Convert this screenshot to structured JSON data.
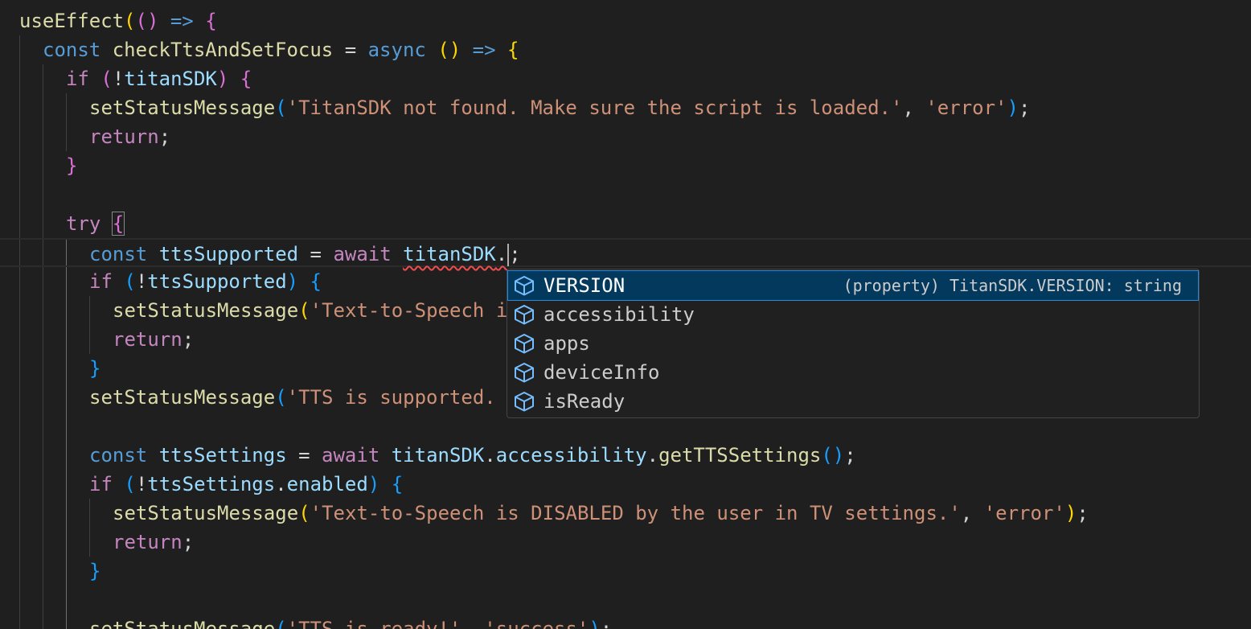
{
  "editor": {
    "comment_fragment": "// ...",
    "lines": [
      {
        "tokens": [
          {
            "t": "useEffect",
            "c": "fn"
          },
          {
            "t": "(",
            "c": "b1"
          },
          {
            "t": "()",
            "c": "b2"
          },
          {
            "t": " => ",
            "c": "kw"
          },
          {
            "t": "{",
            "c": "b2"
          }
        ]
      },
      {
        "tokens": [
          {
            "t": "const ",
            "c": "kw"
          },
          {
            "t": "checkTtsAndSetFocus",
            "c": "fn"
          },
          {
            "t": " = ",
            "c": "pun"
          },
          {
            "t": "async ",
            "c": "kw"
          },
          {
            "t": "()",
            "c": "b1"
          },
          {
            "t": " => ",
            "c": "kw"
          },
          {
            "t": "{",
            "c": "b1"
          }
        ]
      },
      {
        "tokens": [
          {
            "t": "if ",
            "c": "ctl"
          },
          {
            "t": "(",
            "c": "b2"
          },
          {
            "t": "!",
            "c": "pun"
          },
          {
            "t": "titanSDK",
            "c": "var"
          },
          {
            "t": ")",
            "c": "b2"
          },
          {
            "t": " {",
            "c": "b2"
          }
        ]
      },
      {
        "tokens": [
          {
            "t": "setStatusMessage",
            "c": "fn"
          },
          {
            "t": "(",
            "c": "b3"
          },
          {
            "t": "'TitanSDK not found. Make sure the script is loaded.'",
            "c": "str"
          },
          {
            "t": ", ",
            "c": "pun"
          },
          {
            "t": "'error'",
            "c": "str"
          },
          {
            "t": ")",
            "c": "b3"
          },
          {
            "t": ";",
            "c": "pun"
          }
        ]
      },
      {
        "tokens": [
          {
            "t": "return",
            "c": "ctl"
          },
          {
            "t": ";",
            "c": "pun"
          }
        ]
      },
      {
        "tokens": [
          {
            "t": "}",
            "c": "b2"
          }
        ]
      },
      {
        "tokens": []
      },
      {
        "tokens": [
          {
            "t": "try ",
            "c": "ctl"
          },
          {
            "t": "{",
            "c": "b2"
          }
        ]
      },
      {
        "tokens": [
          {
            "t": "const ",
            "c": "kw"
          },
          {
            "t": "ttsSupported",
            "c": "var"
          },
          {
            "t": " = ",
            "c": "pun"
          },
          {
            "t": "await ",
            "c": "ctl"
          },
          {
            "t": "titanSDK",
            "c": "var"
          },
          {
            "t": ".",
            "c": "pun"
          },
          {
            "t": ";",
            "c": "pun"
          }
        ]
      },
      {
        "tokens": [
          {
            "t": "if ",
            "c": "ctl"
          },
          {
            "t": "(",
            "c": "b3"
          },
          {
            "t": "!",
            "c": "pun"
          },
          {
            "t": "ttsSupported",
            "c": "var"
          },
          {
            "t": ")",
            "c": "b3"
          },
          {
            "t": " {",
            "c": "b3"
          }
        ]
      },
      {
        "tokens": [
          {
            "t": "setStatusMessage",
            "c": "fn"
          },
          {
            "t": "(",
            "c": "b1"
          },
          {
            "t": "'Text-to-Speech i",
            "c": "str"
          }
        ]
      },
      {
        "tokens": [
          {
            "t": "return",
            "c": "ctl"
          },
          {
            "t": ";",
            "c": "pun"
          }
        ]
      },
      {
        "tokens": [
          {
            "t": "}",
            "c": "b3"
          }
        ]
      },
      {
        "tokens": [
          {
            "t": "setStatusMessage",
            "c": "fn"
          },
          {
            "t": "(",
            "c": "b3"
          },
          {
            "t": "'TTS is supported.",
            "c": "str"
          }
        ]
      },
      {
        "tokens": []
      },
      {
        "tokens": [
          {
            "t": "const ",
            "c": "kw"
          },
          {
            "t": "ttsSettings",
            "c": "var"
          },
          {
            "t": " = ",
            "c": "pun"
          },
          {
            "t": "await ",
            "c": "ctl"
          },
          {
            "t": "titanSDK",
            "c": "var"
          },
          {
            "t": ".",
            "c": "pun"
          },
          {
            "t": "accessibility",
            "c": "var"
          },
          {
            "t": ".",
            "c": "pun"
          },
          {
            "t": "getTTSSettings",
            "c": "fn"
          },
          {
            "t": "()",
            "c": "b3"
          },
          {
            "t": ";",
            "c": "pun"
          }
        ]
      },
      {
        "tokens": [
          {
            "t": "if ",
            "c": "ctl"
          },
          {
            "t": "(",
            "c": "b3"
          },
          {
            "t": "!",
            "c": "pun"
          },
          {
            "t": "ttsSettings",
            "c": "var"
          },
          {
            "t": ".",
            "c": "pun"
          },
          {
            "t": "enabled",
            "c": "var"
          },
          {
            "t": ")",
            "c": "b3"
          },
          {
            "t": " {",
            "c": "b3"
          }
        ]
      },
      {
        "tokens": [
          {
            "t": "setStatusMessage",
            "c": "fn"
          },
          {
            "t": "(",
            "c": "b1"
          },
          {
            "t": "'Text-to-Speech is DISABLED by the user in TV settings.'",
            "c": "str"
          },
          {
            "t": ", ",
            "c": "pun"
          },
          {
            "t": "'error'",
            "c": "str"
          },
          {
            "t": ")",
            "c": "b1"
          },
          {
            "t": ";",
            "c": "pun"
          }
        ]
      },
      {
        "tokens": [
          {
            "t": "return",
            "c": "ctl"
          },
          {
            "t": ";",
            "c": "pun"
          }
        ]
      },
      {
        "tokens": [
          {
            "t": "}",
            "c": "b3"
          }
        ]
      },
      {
        "tokens": []
      },
      {
        "tokens": [
          {
            "t": "setStatusMessage",
            "c": "fn"
          },
          {
            "t": "(",
            "c": "b3"
          },
          {
            "t": "'TTS is ready!'",
            "c": "str"
          },
          {
            "t": ", ",
            "c": "pun"
          },
          {
            "t": "'success'",
            "c": "str"
          },
          {
            "t": ")",
            "c": "b3"
          },
          {
            "t": ";",
            "c": "pun"
          }
        ]
      }
    ]
  },
  "suggest": {
    "items": [
      {
        "label": "VERSION",
        "detail": "(property) TitanSDK.VERSION: string",
        "icon": "property-cube-icon"
      },
      {
        "label": "accessibility",
        "detail": "",
        "icon": "property-cube-icon"
      },
      {
        "label": "apps",
        "detail": "",
        "icon": "property-cube-icon"
      },
      {
        "label": "deviceInfo",
        "detail": "",
        "icon": "property-cube-icon"
      },
      {
        "label": "isReady",
        "detail": "",
        "icon": "property-cube-icon"
      }
    ]
  },
  "colors": {
    "background": "#1f1f1f",
    "selected_item": "#04395e",
    "error_squiggle": "#f14c4c"
  }
}
